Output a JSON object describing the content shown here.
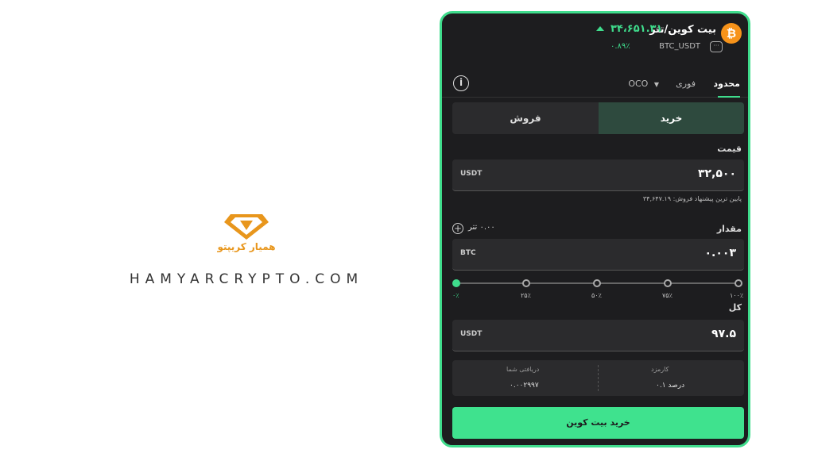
{
  "brand": {
    "fa_name": "همیار کریپتو",
    "en_name": "HAMYARCRYPTO.COM",
    "accent": "#e8961c"
  },
  "header": {
    "coin_icon": "bitcoin-icon",
    "coin_glyph": "₿",
    "pair_name": "بیت کوین/تتر",
    "symbol": "BTC_USDT",
    "last_price": "۳۴،۶۵۱.۳۱",
    "change_pct": "۰.۸۹٪",
    "accent": "#3fdc8c"
  },
  "order_tabs": {
    "limit": "محدود",
    "market": "فوری",
    "oco": "OCO"
  },
  "side": {
    "buy": "خرید",
    "sell": "فروش"
  },
  "price": {
    "label": "قیمت",
    "currency": "USDT",
    "value": "۳۲,۵۰۰",
    "hint": "پایین ترین پیشنهاد فروش: ۳۴,۶۴۷.۱۹"
  },
  "amount": {
    "label": "مقدار",
    "available": "۰.۰۰ تتر",
    "currency": "BTC",
    "value": "۰.۰۰۳"
  },
  "slider": {
    "labels": [
      "۰٪",
      "۲۵٪",
      "۵۰٪",
      "۷۵٪",
      "۱۰۰٪"
    ],
    "selected_fraction": 0
  },
  "total": {
    "label": "کل",
    "currency": "USDT",
    "value": "۹۷.۵"
  },
  "fees": {
    "fee_title": "کارمزد",
    "fee_value": "۰.۱ درصد",
    "receive_title": "دریافتی شما",
    "receive_value": "۰.۰۰۲۹۹۷"
  },
  "submit_label": "خرید بیت کوین"
}
